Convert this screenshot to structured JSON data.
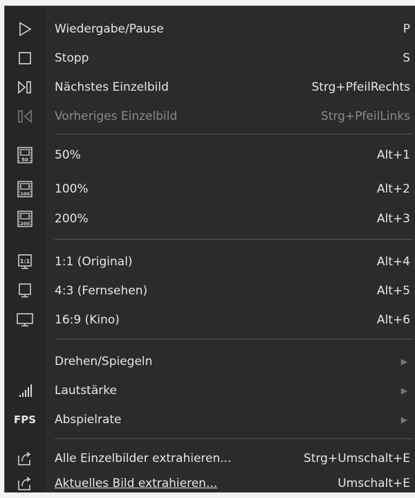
{
  "menu": {
    "items": [
      {
        "label": "Wiedergabe/Pause",
        "shortcut": "P",
        "icon": "play-icon"
      },
      {
        "label": "Stopp",
        "shortcut": "S",
        "icon": "stop-icon"
      },
      {
        "label": "Nächstes Einzelbild",
        "shortcut": "Strg+PfeilRechts",
        "icon": "next-frame-icon"
      },
      {
        "label": "Vorheriges Einzelbild",
        "shortcut": "Strg+PfeilLinks",
        "icon": "previous-frame-icon",
        "disabled": true
      },
      {
        "label": "50%",
        "shortcut": "Alt+1",
        "icon": "zoom-50-icon"
      },
      {
        "label": "100%",
        "shortcut": "Alt+2",
        "icon": "zoom-100-icon"
      },
      {
        "label": "200%",
        "shortcut": "Alt+3",
        "icon": "zoom-200-icon"
      },
      {
        "label": "1:1 (Original)",
        "shortcut": "Alt+4",
        "icon": "aspect-original-icon"
      },
      {
        "label": "4:3 (Fernsehen)",
        "shortcut": "Alt+5",
        "icon": "aspect-4-3-icon"
      },
      {
        "label": "16:9 (Kino)",
        "shortcut": "Alt+6",
        "icon": "aspect-16-9-icon"
      },
      {
        "label": "Drehen/Spiegeln",
        "submenu": true
      },
      {
        "label": "Lautstärke",
        "submenu": true,
        "icon": "volume-icon"
      },
      {
        "label": "Abspielrate",
        "submenu": true,
        "icon": "fps-icon",
        "icon_text": "FPS"
      },
      {
        "label": "Alle Einzelbilder extrahieren...",
        "shortcut": "Strg+Umschalt+E",
        "icon": "export-all-frames-icon"
      },
      {
        "label": "Aktuelles Bild extrahieren...",
        "shortcut": "Umschalt+E",
        "icon": "export-current-frame-icon"
      }
    ],
    "zoom_icon_labels": [
      "50",
      "100",
      "200"
    ],
    "original_icon_label": "1:1"
  },
  "colors": {
    "menu_bg": "#2b2b2b",
    "text": "#e6e6e6",
    "disabled_text": "#8a8a8a",
    "separator": "#555555"
  }
}
